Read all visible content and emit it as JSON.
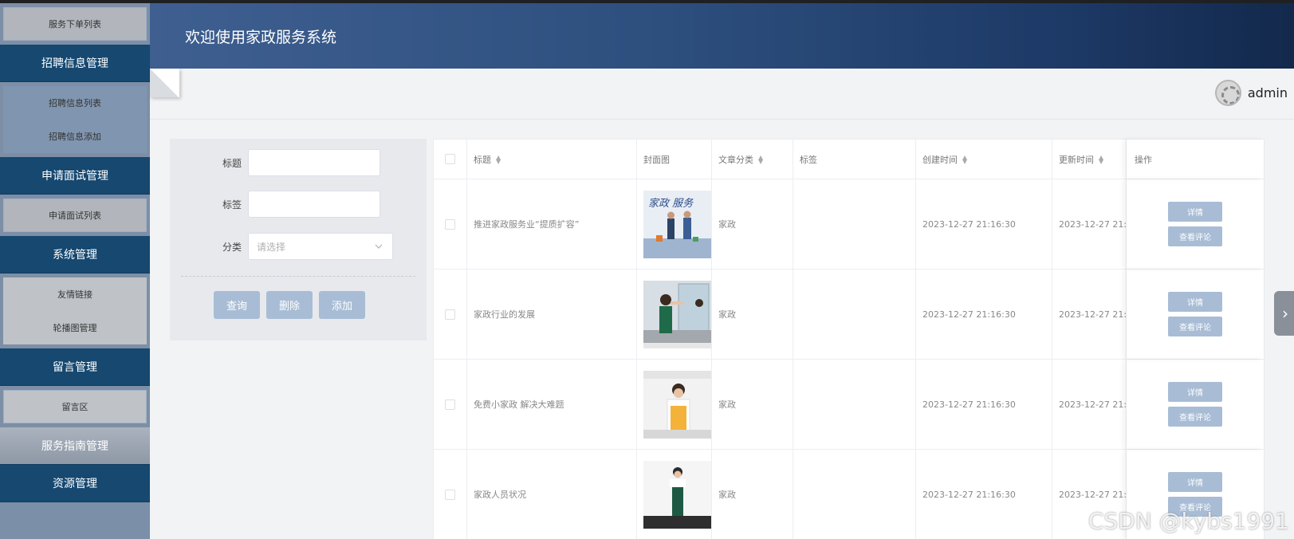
{
  "app": {
    "title": "欢迎使用家政服务系统"
  },
  "user": {
    "name": "admin"
  },
  "sidebar": {
    "top_item": "服务下单列表",
    "groups": [
      {
        "label": "招聘信息管理",
        "items": [
          "招聘信息列表",
          "招聘信息添加"
        ]
      },
      {
        "label": "申请面试管理",
        "items": [
          "申请面试列表"
        ]
      },
      {
        "label": "系统管理",
        "items": [
          "友情链接",
          "轮播图管理"
        ]
      },
      {
        "label": "留言管理",
        "items": [
          "留言区"
        ]
      },
      {
        "label": "服务指南管理",
        "items": []
      },
      {
        "label": "资源管理",
        "items": []
      }
    ]
  },
  "filter": {
    "title_label": "标题",
    "tag_label": "标签",
    "category_label": "分类",
    "category_placeholder": "请选择",
    "query_button": "查询",
    "delete_button": "删除",
    "add_button": "添加"
  },
  "table": {
    "headers": [
      "标题",
      "封面图",
      "文章分类",
      "标签",
      "创建时间",
      "更新时间",
      "操作"
    ],
    "rows": [
      {
        "title": "推进家政服务业“提质扩容”",
        "category": "家政",
        "tag": "",
        "created": "2023-12-27 21:16:30",
        "updated": "2023-12-27 21:2",
        "detail": "详情",
        "comments": "查看评论"
      },
      {
        "title": "家政行业的发展",
        "category": "家政",
        "tag": "",
        "created": "2023-12-27 21:16:30",
        "updated": "2023-12-27 21:1",
        "detail": "详情",
        "comments": "查看评论"
      },
      {
        "title": "免费小家政 解决大难题",
        "category": "家政",
        "tag": "",
        "created": "2023-12-27 21:16:30",
        "updated": "2023-12-27 21:1",
        "detail": "详情",
        "comments": "查看评论"
      },
      {
        "title": "家政人员状况",
        "category": "家政",
        "tag": "",
        "created": "2023-12-27 21:16:30",
        "updated": "2023-12-27 21:1",
        "detail": "详情",
        "comments": "查看评论"
      }
    ]
  },
  "watermark": "CSDN @kybs1991",
  "colors": {
    "sidebar_group": "#164870",
    "button": "#a8bdd5",
    "header_start": "#3e5f90",
    "header_end": "#13294c"
  }
}
